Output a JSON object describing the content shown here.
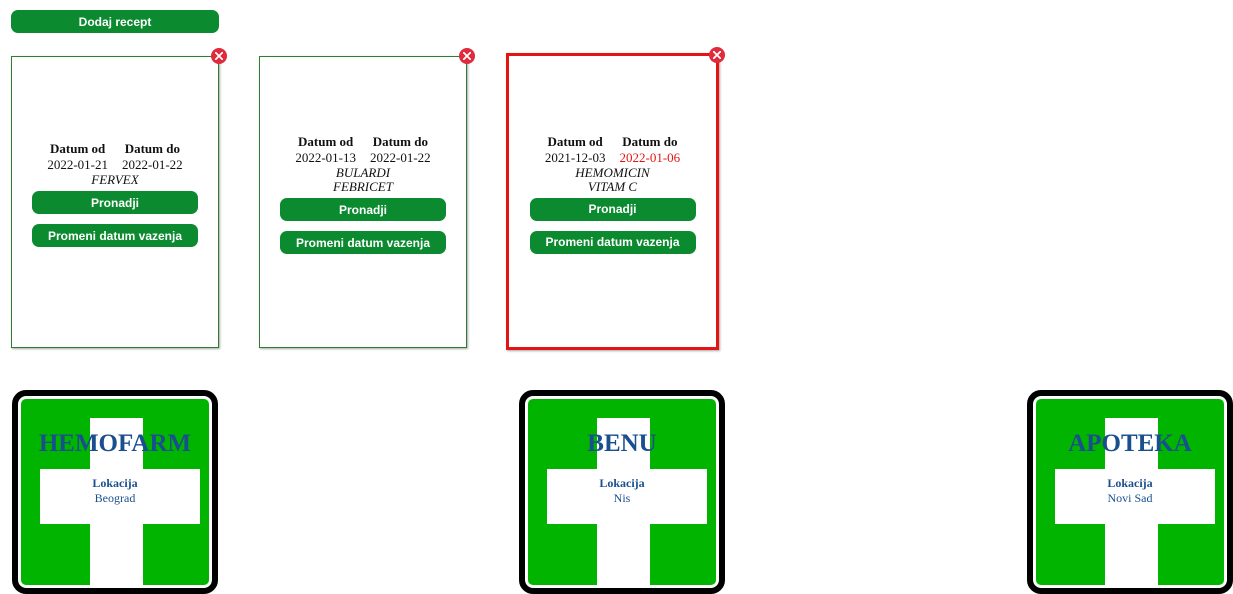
{
  "add_button_label": "Dodaj recept",
  "labels": {
    "date_from": "Datum od",
    "date_to": "Datum do"
  },
  "prescriptions": [
    {
      "date_from": "2022-01-21",
      "date_to": "2022-01-22",
      "medicines": [
        "FERVEX"
      ],
      "find_label": "Pronadji",
      "change_label": "Promeni datum vazenja",
      "expired": false
    },
    {
      "date_from": "2022-01-13",
      "date_to": "2022-01-22",
      "medicines": [
        "BULARDI",
        "FEBRICET"
      ],
      "find_label": "Pronadji",
      "change_label": "Promeni datum vazenja",
      "expired": false
    },
    {
      "date_from": "2021-12-03",
      "date_to": "2022-01-06",
      "medicines": [
        "HEMOMICIN",
        "VITAM C"
      ],
      "find_label": "Pronadji",
      "change_label": "Promeni datum vazenja",
      "expired": true
    }
  ],
  "pharmacies": [
    {
      "name": "HEMOFARM",
      "location_label": "Lokacija",
      "location": "Beograd"
    },
    {
      "name": "BENU",
      "location_label": "Lokacija",
      "location": "Nis"
    },
    {
      "name": "APOTEKA",
      "location_label": "Lokacija",
      "location": "Novi Sad"
    }
  ],
  "colors": {
    "button": "#0b8a2f",
    "expired_border": "#e31414",
    "close_icon": "#e02a3d",
    "pharmacy_bg": "#00b400",
    "pharmacy_text": "#1a4f8e"
  }
}
